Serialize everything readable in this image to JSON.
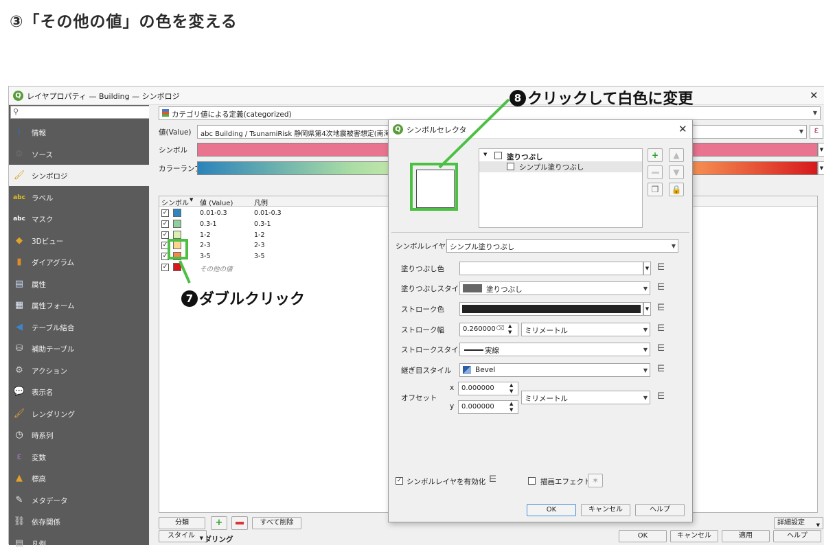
{
  "heading": "③「その他の値」の色を変える",
  "main_window": {
    "title": "レイヤプロパティ — Building — シンボロジ",
    "close": "✕",
    "sidebar": {
      "items": [
        {
          "label": "情報",
          "icon": "info-icon",
          "glyph": "i",
          "color": "#2a6fc0"
        },
        {
          "label": "ソース",
          "icon": "source-icon",
          "glyph": "⚙",
          "color": "#6a6a6a"
        },
        {
          "label": "シンボロジ",
          "icon": "paintbrush-icon",
          "glyph": "🖌",
          "color": "#d8a42a"
        },
        {
          "label": "ラベル",
          "icon": "label-abc-icon",
          "glyph": "abc",
          "color": "#e6c21a"
        },
        {
          "label": "マスク",
          "icon": "mask-abc-icon",
          "glyph": "abc",
          "color": "#fff"
        },
        {
          "label": "3Dビュー",
          "icon": "cube-3d-icon",
          "glyph": "◆",
          "color": "#e2a22b"
        },
        {
          "label": "ダイアグラム",
          "icon": "diagram-icon",
          "glyph": "▮",
          "color": "#e08a2a"
        },
        {
          "label": "属性",
          "icon": "attribute-table-icon",
          "glyph": "▤",
          "color": "#c9d7ef"
        },
        {
          "label": "属性フォーム",
          "icon": "attribute-form-icon",
          "glyph": "▦",
          "color": "#dfe7f5"
        },
        {
          "label": "テーブル結合",
          "icon": "join-icon",
          "glyph": "◀",
          "color": "#3b86d1"
        },
        {
          "label": "補助テーブル",
          "icon": "auxiliary-storage-icon",
          "glyph": "⛁",
          "color": "#cfcfcf"
        },
        {
          "label": "アクション",
          "icon": "action-gear-icon",
          "glyph": "⚙",
          "color": "#cfcfcf"
        },
        {
          "label": "表示名",
          "icon": "display-name-icon",
          "glyph": "💬",
          "color": "#f1d24a"
        },
        {
          "label": "レンダリング",
          "icon": "rendering-brush-icon",
          "glyph": "🖌",
          "color": "#e0a030"
        },
        {
          "label": "時系列",
          "icon": "clock-icon",
          "glyph": "◷",
          "color": "#fff"
        },
        {
          "label": "変数",
          "icon": "variable-icon",
          "glyph": "ε",
          "color": "#b07ac9"
        },
        {
          "label": "標高",
          "icon": "elevation-icon",
          "glyph": "▲",
          "color": "#e2a22b"
        },
        {
          "label": "メタデータ",
          "icon": "metadata-icon",
          "glyph": "✎",
          "color": "#e8e8e8"
        },
        {
          "label": "依存関係",
          "icon": "dependencies-icon",
          "glyph": "⛓",
          "color": "#dcdcdc"
        },
        {
          "label": "凡例",
          "icon": "legend-icon",
          "glyph": "▤",
          "color": "#d0d0d0"
        }
      ]
    },
    "renderer_type": "カテゴリ値による定義(categorized)",
    "value_label": "値(Value)",
    "value_field": "abc Building / TsunamiRisk 静岡県第4次地震被害想定(南海",
    "symbol_label": "シンボル",
    "ramp_label": "カラーランプ",
    "epsilon": "ε",
    "table": {
      "headers": [
        "シンボル",
        "値 (Value)",
        "凡例"
      ],
      "rows": [
        {
          "checked": "✓",
          "color": "#2e86c1",
          "value": "0.01-0.3",
          "legend": "0.01-0.3"
        },
        {
          "checked": "✓",
          "color": "#8fcf9f",
          "value": "0.3-1",
          "legend": "0.3-1"
        },
        {
          "checked": "✓",
          "color": "#dbefb2",
          "value": "1-2",
          "legend": "1-2"
        },
        {
          "checked": "✓",
          "color": "#fbd58e",
          "value": "2-3",
          "legend": "2-3"
        },
        {
          "checked": "✓",
          "color": "#f08a4e",
          "value": "3-5",
          "legend": "3-5"
        },
        {
          "checked": "✓",
          "color": "#d7191c",
          "value": "その他の値",
          "legend": ""
        }
      ]
    },
    "buttons": {
      "classify": "分類",
      "delete_all": "すべて削除",
      "advanced": "詳細設定",
      "layer_rendering": "レイヤレンダリング",
      "style": "スタイル",
      "ok": "OK",
      "cancel": "キャンセル",
      "apply": "適用",
      "help": "ヘルプ"
    }
  },
  "symbol_dialog": {
    "title": "シンボルセレクタ",
    "close": "✕",
    "tree": {
      "root": "塗りつぶし",
      "child": "シンプル塗りつぶし"
    },
    "layer_type_label": "シンボルレイヤ型",
    "layer_type": "シンプル塗りつぶし",
    "fields": {
      "fill_color_label": "塗りつぶし色",
      "fill_style_label": "塗りつぶしスタイル",
      "fill_style": "塗りつぶし",
      "stroke_color_label": "ストローク色",
      "stroke_width_label": "ストローク幅",
      "stroke_width": "0.260000",
      "stroke_unit": "ミリメートル",
      "stroke_style_label": "ストロークスタイル",
      "stroke_style": "実線",
      "join_style_label": "継ぎ目スタイル",
      "join_style": "Bevel",
      "offset_label": "オフセット",
      "offset_x_label": "x",
      "offset_x": "0.000000",
      "offset_y_label": "y",
      "offset_y": "0.000000",
      "offset_unit": "ミリメートル"
    },
    "enable_layer": "シンボルレイヤを有効化",
    "draw_effects": "描画エフェクト",
    "ok": "OK",
    "cancel": "キャンセル",
    "help": "ヘルプ"
  },
  "annotations": {
    "step7_num": "7",
    "step7_text": "ダブルクリック",
    "step8_num": "8",
    "step8_text": "クリックして白色に変更"
  }
}
